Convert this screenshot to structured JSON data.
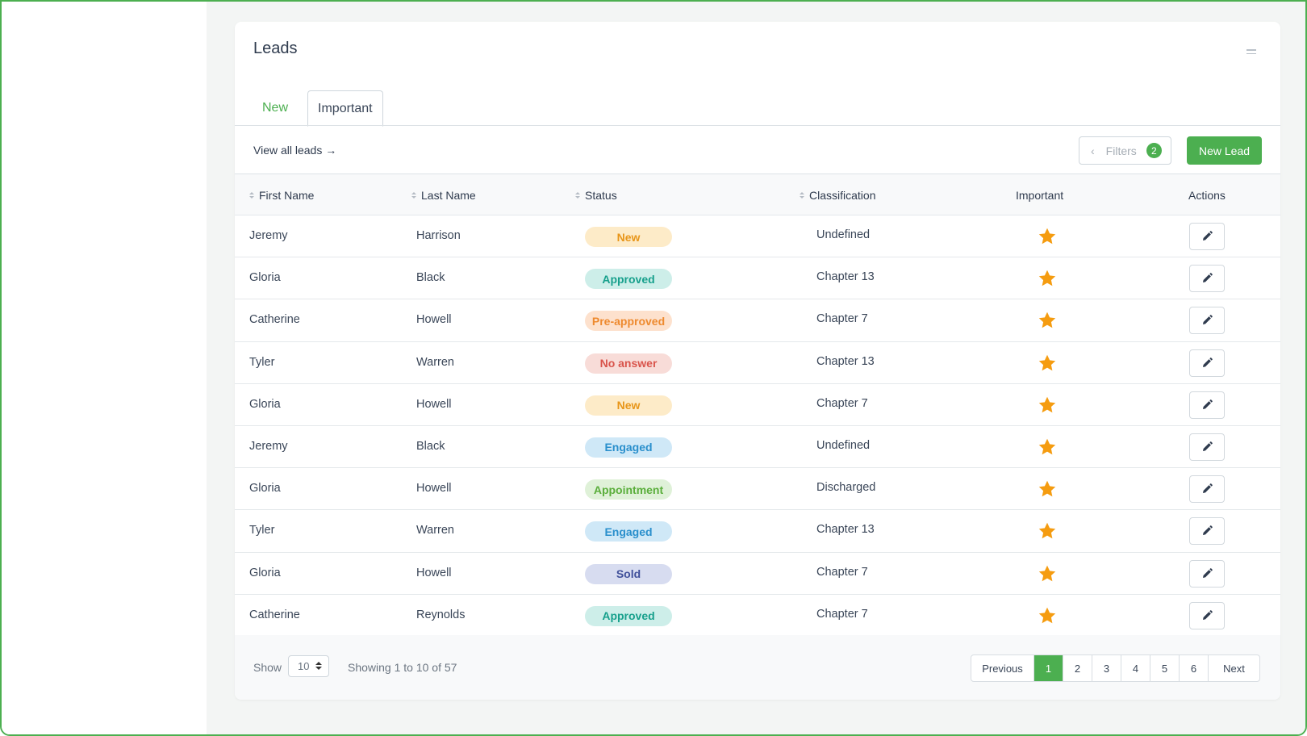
{
  "card": {
    "title": "Leads"
  },
  "tabs": [
    {
      "label": "New"
    },
    {
      "label": "Important"
    }
  ],
  "toolbar": {
    "view_all_label": "View all leads →",
    "filters_label": "Filters",
    "filters_count": "2",
    "new_lead_label": "New Lead"
  },
  "columns": {
    "first_name": "First Name",
    "last_name": "Last Name",
    "status": "Status",
    "classification": "Classification",
    "important": "Important",
    "actions": "Actions"
  },
  "status_colors": {
    "New": {
      "bg": "#fdebc8",
      "fg": "#e8961a"
    },
    "Approved": {
      "bg": "#cdeee9",
      "fg": "#17a08c"
    },
    "Pre-approved": {
      "bg": "#fde1cd",
      "fg": "#ee8a2f"
    },
    "No answer": {
      "bg": "#f8dcd8",
      "fg": "#d9544b"
    },
    "Engaged": {
      "bg": "#cfe8f7",
      "fg": "#2a8fcc"
    },
    "Appointment": {
      "bg": "#dff1d8",
      "fg": "#5aae3b"
    },
    "Sold": {
      "bg": "#d7dcf0",
      "fg": "#3f4f9a"
    }
  },
  "star_color": "#f59c10",
  "rows": [
    {
      "first": "Jeremy",
      "last": "Harrison",
      "status": "New",
      "classification": "Undefined"
    },
    {
      "first": "Gloria",
      "last": "Black",
      "status": "Approved",
      "classification": "Chapter 13"
    },
    {
      "first": "Catherine",
      "last": "Howell",
      "status": "Pre-approved",
      "classification": "Chapter 7"
    },
    {
      "first": "Tyler",
      "last": "Warren",
      "status": "No answer",
      "classification": "Chapter 13"
    },
    {
      "first": "Gloria",
      "last": "Howell",
      "status": "New",
      "classification": "Chapter 7"
    },
    {
      "first": "Jeremy",
      "last": "Black",
      "status": "Engaged",
      "classification": "Undefined"
    },
    {
      "first": "Gloria",
      "last": "Howell",
      "status": "Appointment",
      "classification": "Discharged"
    },
    {
      "first": "Tyler",
      "last": "Warren",
      "status": "Engaged",
      "classification": "Chapter 13"
    },
    {
      "first": "Gloria",
      "last": "Howell",
      "status": "Sold",
      "classification": "Chapter 7"
    },
    {
      "first": "Catherine",
      "last": "Reynolds",
      "status": "Approved",
      "classification": "Chapter 7"
    }
  ],
  "footer": {
    "show_label": "Show",
    "page_size": "10",
    "showing_text": "Showing 1 to 10 of 57"
  },
  "pagination": {
    "previous_label": "Previous",
    "pages": [
      "1",
      "2",
      "3",
      "4",
      "5",
      "6"
    ],
    "active_page": "1",
    "next_label": "Next"
  }
}
